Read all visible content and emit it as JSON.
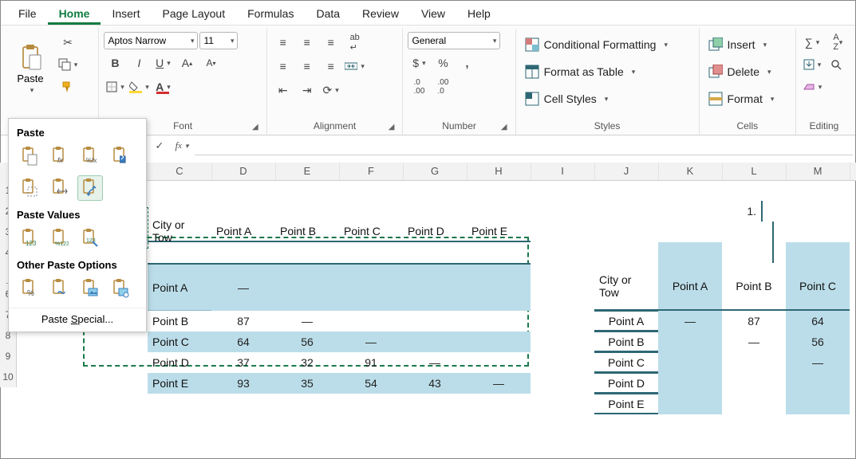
{
  "menu": {
    "items": [
      "File",
      "Home",
      "Insert",
      "Page Layout",
      "Formulas",
      "Data",
      "Review",
      "View",
      "Help"
    ],
    "active": "Home"
  },
  "ribbon": {
    "clipboard": {
      "paste": "Paste",
      "label": ""
    },
    "font": {
      "name": "Aptos Narrow",
      "size": "11",
      "label": "Font"
    },
    "alignment": {
      "label": "Alignment"
    },
    "number": {
      "format": "General",
      "label": "Number"
    },
    "styles": {
      "cond": "Conditional Formatting",
      "table": "Format as Table",
      "cellstyles": "Cell Styles",
      "label": "Styles"
    },
    "cells": {
      "insert": "Insert",
      "delete": "Delete",
      "format": "Format",
      "label": "Cells"
    },
    "editing": {
      "label": "Editing"
    }
  },
  "paste_menu": {
    "head1": "Paste",
    "head2": "Paste Values",
    "head3": "Other Paste Options",
    "special": "Paste Special..."
  },
  "formula_bar": {
    "value": ""
  },
  "cols": [
    "C",
    "D",
    "E",
    "F",
    "G",
    "H",
    "I",
    "J",
    "K",
    "L",
    "M"
  ],
  "rows": [
    "1",
    "2",
    "3",
    "4",
    "5",
    "6",
    "7",
    "8",
    "9",
    "10"
  ],
  "left_table": {
    "title_first": "City or Tow",
    "headers": [
      "Point A",
      "Point B",
      "Point C",
      "Point D",
      "Point E"
    ],
    "rows": [
      {
        "n": "Point A",
        "v": [
          "—",
          "",
          "",
          "",
          ""
        ]
      },
      {
        "n": "Point B",
        "v": [
          "87",
          "—",
          "",
          "",
          ""
        ]
      },
      {
        "n": "Point C",
        "v": [
          "64",
          "56",
          "—",
          "",
          ""
        ]
      },
      {
        "n": "Point D",
        "v": [
          "37",
          "32",
          "91",
          "—",
          ""
        ]
      },
      {
        "n": "Point E",
        "v": [
          "93",
          "35",
          "54",
          "43",
          "—"
        ]
      }
    ]
  },
  "right_corner": "1.",
  "right_table": {
    "title_first": "City or Tow",
    "headers": [
      "Point A",
      "Point B",
      "Point C"
    ],
    "rows": [
      {
        "n": "Point A",
        "v": [
          "—",
          "87",
          "64"
        ]
      },
      {
        "n": "Point B",
        "v": [
          "",
          "—",
          "56"
        ]
      },
      {
        "n": "Point C",
        "v": [
          "",
          "",
          "—"
        ]
      },
      {
        "n": "Point D",
        "v": [
          "",
          "",
          ""
        ]
      },
      {
        "n": "Point E",
        "v": [
          "",
          "",
          ""
        ]
      }
    ]
  }
}
